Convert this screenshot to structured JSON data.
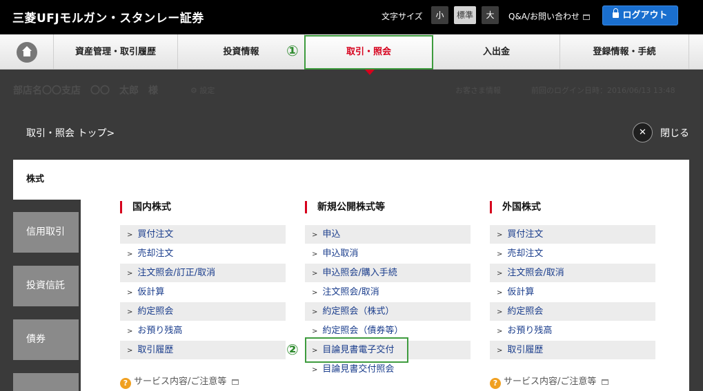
{
  "header": {
    "logo": "三菱UFJモルガン・スタンレー証券",
    "font_size_label": "文字サイズ",
    "font_sizes": [
      "小",
      "標準",
      "大"
    ],
    "qa_link": "Q&A/お問い合わせ",
    "logout": "ログアウト"
  },
  "nav": {
    "items": [
      "資産管理・取引履歴",
      "投資情報",
      "取引・照会",
      "入出金",
      "登録情報・手続"
    ],
    "active": "取引・照会"
  },
  "markers": [
    "①",
    "②"
  ],
  "dimmed": {
    "branch_user": "部店名〇〇支店　〇〇　太郎　様",
    "settings": "設定",
    "customer_info": "お客さま情報",
    "last_login": "前回のログイン日時：2016/06/13 13:48"
  },
  "breadcrumb": "取引・照会 トップ>",
  "close_label": "閉じる",
  "side_tabs": [
    "株式",
    "信用取引",
    "投資信託",
    "債券"
  ],
  "columns": [
    {
      "heading": "国内株式",
      "links": [
        "買付注文",
        "売却注文",
        "注文照会/訂正/取消",
        "仮計算",
        "約定照会",
        "お預り残高",
        "取引履歴"
      ],
      "service": "サービス内容/ご注意等"
    },
    {
      "heading": "新規公開株式等",
      "links": [
        "申込",
        "申込取消",
        "申込照会/購入手続",
        "注文照会/取消",
        "約定照会（株式）",
        "約定照会（債券等）",
        "目論見書電子交付",
        "目論見書交付照会"
      ],
      "service": ""
    },
    {
      "heading": "外国株式",
      "links": [
        "買付注文",
        "売却注文",
        "注文照会/取消",
        "仮計算",
        "約定照会",
        "お預り残高",
        "取引履歴"
      ],
      "service": "サービス内容/ご注意等"
    }
  ],
  "colors": {
    "accent_red": "#d6001c",
    "highlight_green": "#3d9b3d",
    "logout_blue": "#1a6fcf"
  }
}
